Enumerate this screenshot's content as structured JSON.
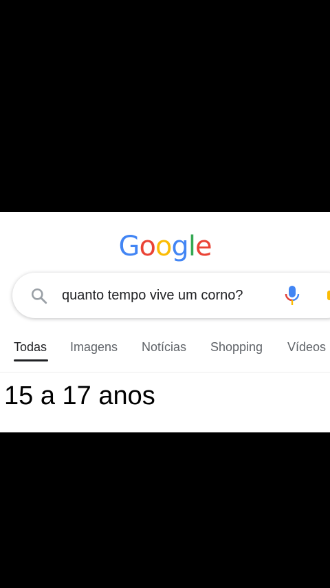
{
  "logo": {
    "letters": [
      "G",
      "o",
      "o",
      "g",
      "l",
      "e"
    ],
    "colors": [
      "#4285f4",
      "#ea4335",
      "#fbbc05",
      "#4285f4",
      "#34a853",
      "#ea4335"
    ]
  },
  "search": {
    "query": "quanto tempo vive um corno?",
    "icon": "search-icon",
    "mic_icon": "mic-icon"
  },
  "tabs": [
    {
      "label": "Todas",
      "active": true
    },
    {
      "label": "Imagens",
      "active": false
    },
    {
      "label": "Notícias",
      "active": false
    },
    {
      "label": "Shopping",
      "active": false
    },
    {
      "label": "Vídeos",
      "active": false
    }
  ],
  "answer": "15 a 17 anos",
  "colors": {
    "text_primary": "#202124",
    "text_secondary": "#5f6368",
    "mic_blue": "#4285f4",
    "mic_red": "#ea4335",
    "mic_yellow": "#fbbc05",
    "mic_green": "#34a853"
  }
}
